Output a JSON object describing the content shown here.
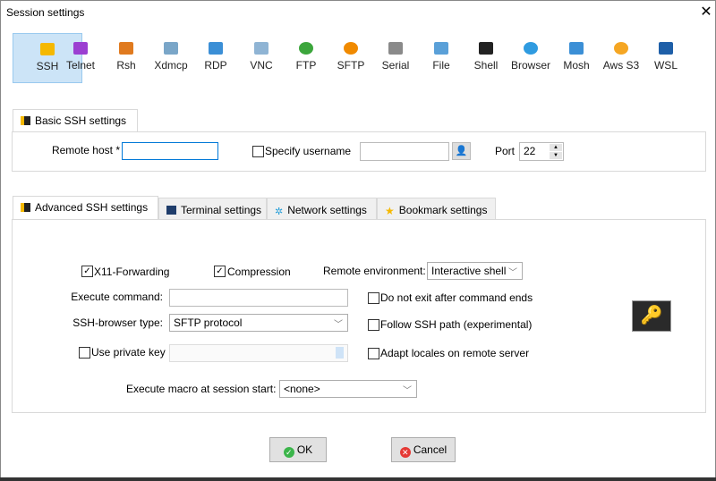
{
  "window": {
    "title": "Session settings",
    "close_icon": "close-icon"
  },
  "protocols": [
    {
      "label": "SSH",
      "icon": "ssh-key-icon",
      "color": "#f5b800",
      "selected": true
    },
    {
      "label": "Telnet",
      "icon": "telnet-icon",
      "color": "#9b3fd1"
    },
    {
      "label": "Rsh",
      "icon": "rsh-gears-icon",
      "color": "#e07a1f"
    },
    {
      "label": "Xdmcp",
      "icon": "xdmcp-x-icon",
      "color": "#7aa6c8"
    },
    {
      "label": "RDP",
      "icon": "rdp-monitor-icon",
      "color": "#3b8fd6"
    },
    {
      "label": "VNC",
      "icon": "vnc-monitor-icon",
      "color": "#8fb4d4"
    },
    {
      "label": "FTP",
      "icon": "ftp-globe-icon",
      "color": "#3ca63c"
    },
    {
      "label": "SFTP",
      "icon": "sftp-globe-icon",
      "color": "#f08a00"
    },
    {
      "label": "Serial",
      "icon": "serial-plug-icon",
      "color": "#8a8a8a"
    },
    {
      "label": "File",
      "icon": "file-monitor-icon",
      "color": "#5aa0d8"
    },
    {
      "label": "Shell",
      "icon": "shell-terminal-icon",
      "color": "#222222"
    },
    {
      "label": "Browser",
      "icon": "browser-globe-icon",
      "color": "#2f9be0"
    },
    {
      "label": "Mosh",
      "icon": "mosh-satellite-icon",
      "color": "#3b8fd6"
    },
    {
      "label": "Aws S3",
      "icon": "aws-s3-icon",
      "color": "#f5a623"
    },
    {
      "label": "WSL",
      "icon": "wsl-windows-icon",
      "color": "#1e5fa8"
    }
  ],
  "basic": {
    "tab_label": "Basic SSH settings",
    "remote_host_label": "Remote host *",
    "remote_host_value": "",
    "specify_username_label": "Specify username",
    "specify_username_checked": false,
    "username_value": "",
    "port_label": "Port",
    "port_value": "22"
  },
  "advanced_tabs": [
    {
      "label": "Advanced SSH settings",
      "active": true
    },
    {
      "label": "Terminal settings"
    },
    {
      "label": "Network settings"
    },
    {
      "label": "Bookmark settings"
    }
  ],
  "advanced": {
    "x11_label": "X11-Forwarding",
    "x11_checked": true,
    "compression_label": "Compression",
    "compression_checked": true,
    "remote_env_label": "Remote environment:",
    "remote_env_value": "Interactive shell",
    "exec_cmd_label": "Execute command:",
    "exec_cmd_value": "",
    "no_exit_label": "Do not exit after command ends",
    "browser_type_label": "SSH-browser type:",
    "browser_type_value": "SFTP protocol",
    "follow_path_label": "Follow SSH path (experimental)",
    "private_key_label": "Use private key",
    "private_key_value": "",
    "adapt_locales_label": "Adapt locales on remote server",
    "macro_label": "Execute macro at session start:",
    "macro_value": "<none>"
  },
  "buttons": {
    "ok": "OK",
    "cancel": "Cancel"
  }
}
